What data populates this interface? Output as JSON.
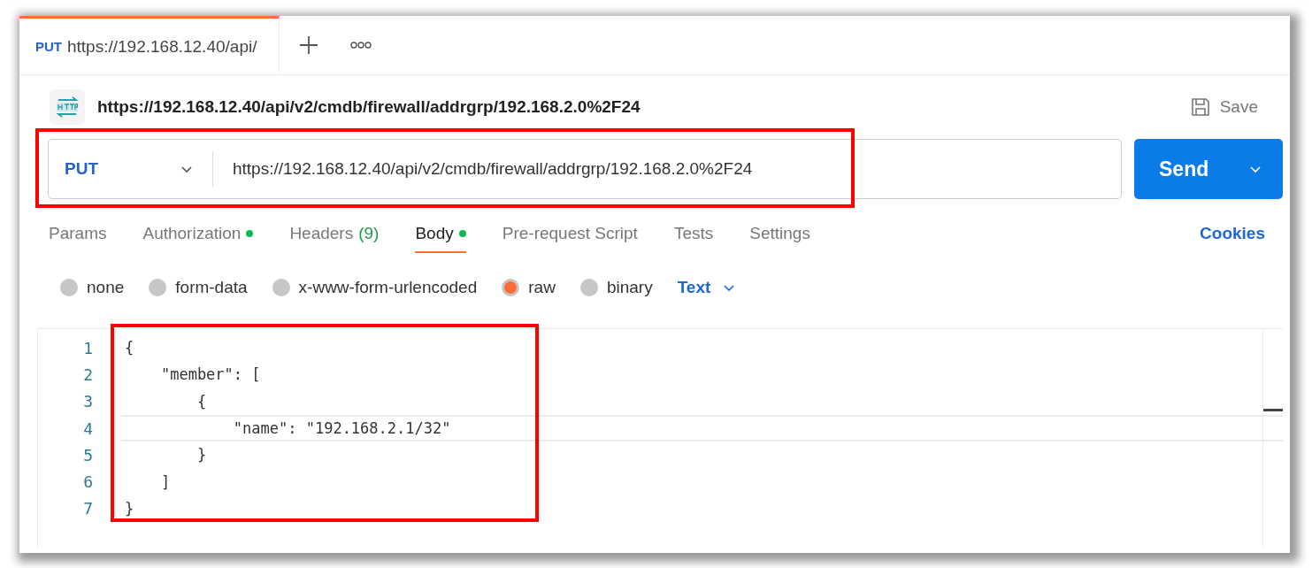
{
  "tab": {
    "method": "PUT",
    "title": "https://192.168.12.40/api/",
    "selected": true
  },
  "header": {
    "url": "https://192.168.12.40/api/v2/cmdb/firewall/addrgrp/192.168.2.0%2F24",
    "save": "Save"
  },
  "request_bar": {
    "method": "PUT",
    "url": "https://192.168.12.40/api/v2/cmdb/firewall/addrgrp/192.168.2.0%2F24",
    "send": "Send",
    "highlight": true
  },
  "request_tabs": [
    {
      "label": "Params",
      "selected": false,
      "dot": false
    },
    {
      "label": "Authorization",
      "selected": false,
      "dot": true
    },
    {
      "label": "Headers",
      "count": "(9)",
      "selected": false,
      "dot": false
    },
    {
      "label": "Body",
      "selected": true,
      "dot": true
    },
    {
      "label": "Pre-request Script",
      "selected": false,
      "dot": false
    },
    {
      "label": "Tests",
      "selected": false,
      "dot": false
    },
    {
      "label": "Settings",
      "selected": false,
      "dot": false
    }
  ],
  "cookies": "Cookies",
  "body_types": [
    {
      "label": "none",
      "selected": false
    },
    {
      "label": "form-data",
      "selected": false
    },
    {
      "label": "x-www-form-urlencoded",
      "selected": false
    },
    {
      "label": "raw",
      "selected": true
    },
    {
      "label": "binary",
      "selected": false
    }
  ],
  "format": "Text",
  "editor": {
    "highlight": true,
    "lines": [
      {
        "number": "1",
        "code": "{",
        "active": false
      },
      {
        "number": "2",
        "code": "    \"member\": [",
        "active": false
      },
      {
        "number": "3",
        "code": "        {",
        "active": false
      },
      {
        "number": "4",
        "code": "            \"name\": \"192.168.2.1/32\"",
        "active": true
      },
      {
        "number": "5",
        "code": "        }",
        "active": false
      },
      {
        "number": "6",
        "code": "    ]",
        "active": false
      },
      {
        "number": "7",
        "code": "}",
        "active": false
      }
    ]
  }
}
